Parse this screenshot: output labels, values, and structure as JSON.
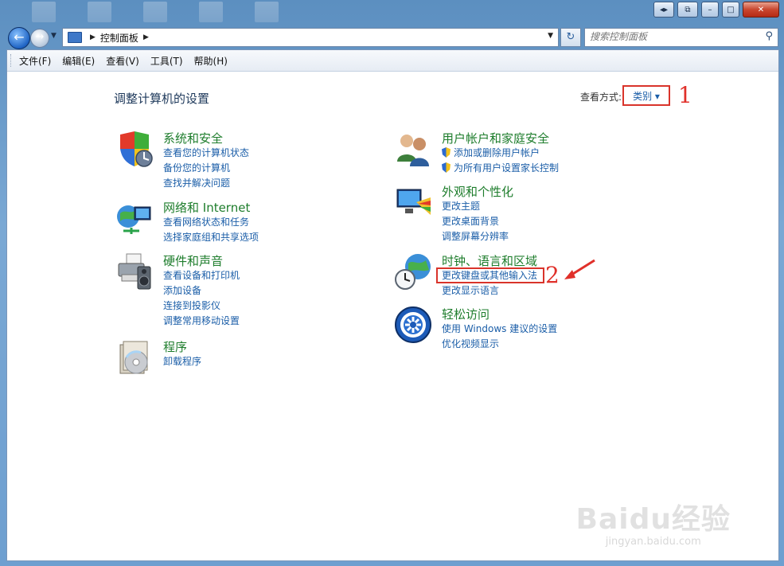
{
  "window": {
    "caption_buttons": [
      "back-forward",
      "restore-small",
      "minimize",
      "maximize",
      "close"
    ]
  },
  "address_bar": {
    "crumb": "控制面板",
    "search_placeholder": "搜索控制面板"
  },
  "menu": [
    "文件(F)",
    "编辑(E)",
    "查看(V)",
    "工具(T)",
    "帮助(H)"
  ],
  "main": {
    "heading": "调整计算机的设置",
    "view_by_label": "查看方式:",
    "view_by_value": "类别 ▾",
    "annotation_1": "1",
    "annotation_2": "2"
  },
  "categories_left": [
    {
      "title": "系统和安全",
      "icon": "security-shield-icon",
      "links": [
        "查看您的计算机状态",
        "备份您的计算机",
        "查找并解决问题"
      ]
    },
    {
      "title": "网络和 Internet",
      "icon": "network-globe-icon",
      "links": [
        "查看网络状态和任务",
        "选择家庭组和共享选项"
      ]
    },
    {
      "title": "硬件和声音",
      "icon": "printer-speaker-icon",
      "links": [
        "查看设备和打印机",
        "添加设备",
        "连接到投影仪",
        "调整常用移动设置"
      ]
    },
    {
      "title": "程序",
      "icon": "programs-disc-icon",
      "links": [
        "卸载程序"
      ]
    }
  ],
  "categories_right": [
    {
      "title": "用户帐户和家庭安全",
      "icon": "users-icon",
      "links": [
        "添加或删除用户帐户",
        "为所有用户设置家长控制"
      ]
    },
    {
      "title": "外观和个性化",
      "icon": "monitor-palette-icon",
      "links": [
        "更改主题",
        "更改桌面背景",
        "调整屏幕分辨率"
      ]
    },
    {
      "title": "时钟、语言和区域",
      "icon": "clock-globe-icon",
      "links": [
        "更改键盘或其他输入法",
        "更改显示语言"
      ]
    },
    {
      "title": "轻松访问",
      "icon": "ease-of-access-icon",
      "links": [
        "使用 Windows 建议的设置",
        "优化视频显示"
      ]
    }
  ],
  "watermark": {
    "brand": "Baidu经验",
    "url": "jingyan.baidu.com"
  },
  "colors": {
    "link": "#1b5ea8",
    "category_title": "#1e7d2c",
    "annotation": "#e0302a"
  }
}
